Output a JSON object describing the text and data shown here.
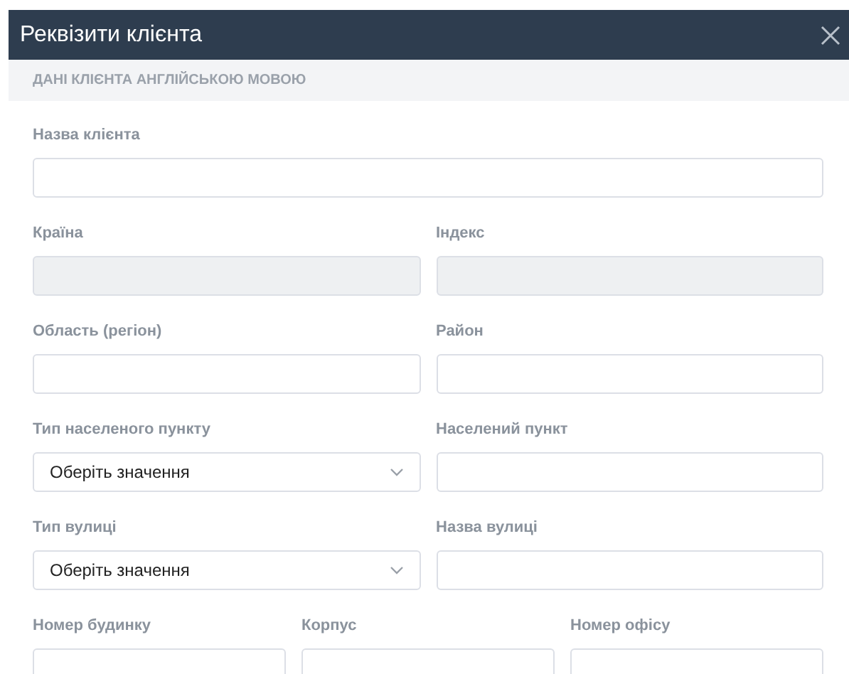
{
  "window": {
    "title": "Реквізити клієнта"
  },
  "section": {
    "title": "ДАНІ КЛІЄНТА АНГЛІЙСЬКОЮ МОВОЮ"
  },
  "rows": [
    [
      {
        "label": "Назва клієнта",
        "kind": "text",
        "disabled": false
      }
    ],
    [
      {
        "label": "Країна",
        "kind": "text",
        "disabled": true
      },
      {
        "label": "Індекс",
        "kind": "text",
        "disabled": true
      }
    ],
    [
      {
        "label": "Область (регіон)",
        "kind": "text",
        "disabled": false
      },
      {
        "label": "Район",
        "kind": "text",
        "disabled": false
      }
    ],
    [
      {
        "label": "Тип населеного пункту",
        "kind": "select",
        "value": "Оберіть значення",
        "disabled": false
      },
      {
        "label": "Населений пункт",
        "kind": "text",
        "disabled": false
      }
    ],
    [
      {
        "label": "Тип вулиці",
        "kind": "select",
        "value": "Оберіть значення",
        "disabled": false
      },
      {
        "label": "Назва вулиці",
        "kind": "text",
        "disabled": false
      }
    ],
    [
      {
        "label": "Номер будинку",
        "kind": "text",
        "disabled": false
      },
      {
        "label": "Корпус",
        "kind": "text",
        "disabled": false
      },
      {
        "label": "Номер офісу",
        "kind": "text",
        "disabled": false
      }
    ]
  ]
}
